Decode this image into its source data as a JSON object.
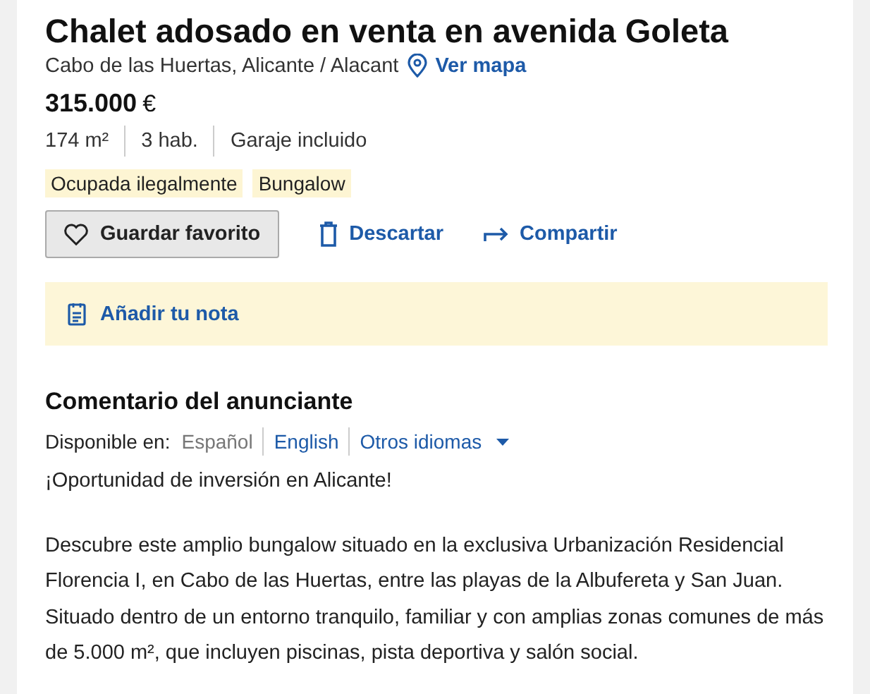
{
  "title": "Chalet adosado en venta en avenida Goleta",
  "location": {
    "address": "Cabo de las Huertas, Alicante / Alacant",
    "map_link": "Ver mapa"
  },
  "price": {
    "amount": "315.000",
    "currency": "€"
  },
  "features": [
    "174 m²",
    "3 hab.",
    "Garaje incluido"
  ],
  "tags": [
    "Ocupada ilegalmente",
    "Bungalow"
  ],
  "actions": [
    {
      "kind": "favorite",
      "label": "Guardar favorito"
    },
    {
      "kind": "discard",
      "label": "Descartar"
    },
    {
      "kind": "share",
      "label": "Compartir"
    }
  ],
  "note": {
    "label": "Añadir tu nota"
  },
  "comment": {
    "heading": "Comentario del anunciante",
    "available_label": "Disponible en:",
    "languages": [
      {
        "label": "Español",
        "selected": true,
        "kind": "option"
      },
      {
        "label": "English",
        "selected": false,
        "kind": "option"
      },
      {
        "label": "Otros idiomas",
        "selected": false,
        "kind": "dropdown"
      }
    ],
    "paragraphs": [
      "¡Oportunidad de inversión en Alicante!",
      "Descubre este amplio bungalow situado en la exclusiva Urbanización Residencial Florencia I, en Cabo de las Huertas, entre las playas de la Albufereta y San Juan. Situado dentro de un entorno tranquilo, familiar y con amplias zonas comunes de más de 5.000 m², que incluyen piscinas, pista deportiva y salón social."
    ]
  }
}
